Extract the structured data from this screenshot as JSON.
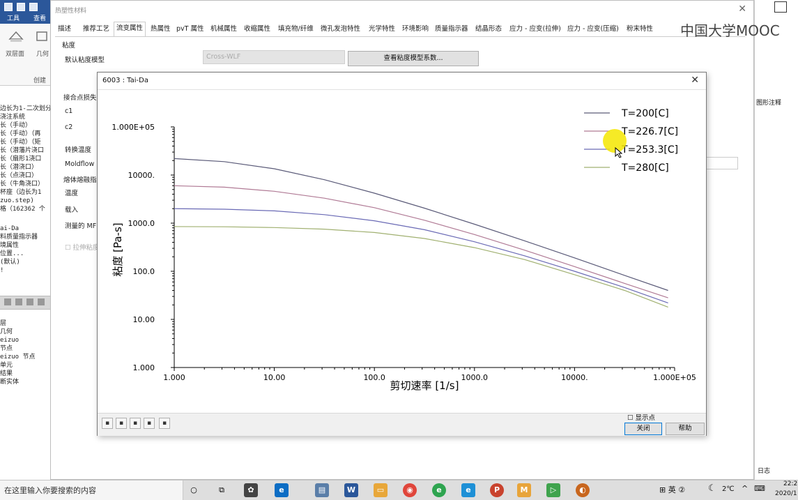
{
  "app": {
    "ribbon_tabs": [
      "工具",
      "查看"
    ],
    "ribbon_labels": [
      "双层面",
      "几何"
    ],
    "ribbon_group": "创建",
    "tree_top": [
      "边长为1-二次划分",
      "浇注系统",
      "长（手动）",
      "长（手动）（再",
      "长（手动）（矩",
      "长（潜藩片浇口",
      "长（扇形1浇口",
      "长（潜浇口）",
      "长（点浇口）",
      "长（牛角浇口）",
      "  杯座（边长为1",
      "zuo.step)",
      "格（162362 个"
    ],
    "tree_mid": [
      "ai-Da",
      "料质量指示器",
      "境属性",
      "位置...",
      " (默认)",
      "!"
    ],
    "tree_bottom": [
      "层",
      " 几何",
      "eizuo",
      "节点",
      "eizuo  节点",
      "单元",
      "结果",
      "断实体"
    ],
    "right_labels": [
      "图形注释",
      "日志"
    ],
    "watermark": "中国大学MOOC"
  },
  "bg_dialog": {
    "title": "热塑性材料",
    "tabs": [
      "描述",
      "推荐工艺",
      "流变属性",
      "热属性",
      "pvT 属性",
      "机械属性",
      "收缩属性",
      "填充物/纤维",
      "微孔发泡特性",
      "光学特性",
      "环境影响",
      "质量指示器",
      "结晶形态",
      "应力 - 应变(拉伸)",
      "应力 - 应变(压缩)",
      "粉末特性"
    ],
    "section": "粘度",
    "model_label": "默认粘度模型",
    "model_value": "Cross-WLF",
    "coeff_button": "查看粘度模型系数...",
    "labels": [
      "接合点损失",
      "c1",
      "c2",
      "转换温度",
      "Moldflow",
      "熔体熔融指",
      "温度",
      "载入",
      "测量的 MF",
      "拉伸粘度"
    ]
  },
  "plot_window": {
    "title": "6003 : Tai-Da",
    "show_points_label": "显示点",
    "close_button": "关闭",
    "help_button": "帮助"
  },
  "chart_data": {
    "type": "line",
    "xlabel": "剪切速率 [1/s]",
    "ylabel": "粘度 [Pa-s]",
    "x_scale": "log",
    "y_scale": "log",
    "xlim": [
      1,
      100000
    ],
    "ylim": [
      1,
      100000
    ],
    "x_ticks": [
      "1.000",
      "10.00",
      "100.0",
      "1000.0",
      "10000.",
      "1.000E+05"
    ],
    "y_ticks": [
      "1.000",
      "10.00",
      "100.0",
      "1000.0",
      "10000.",
      "1.000E+05"
    ],
    "grid": false,
    "legend": "top-right",
    "x": [
      1,
      3.16,
      10,
      31.6,
      100,
      316,
      1000,
      3160,
      10000,
      31600,
      86000
    ],
    "series": [
      {
        "name": "T=200[C]",
        "color": "#5a5a78",
        "values": [
          22000,
          19000,
          13500,
          8000,
          4200,
          2050,
          950,
          430,
          190,
          82,
          40
        ]
      },
      {
        "name": "T=226.7[C]",
        "color": "#b07a95",
        "values": [
          6000,
          5600,
          4600,
          3300,
          2100,
          1150,
          580,
          275,
          125,
          56,
          28
        ]
      },
      {
        "name": "T=253.3[C]",
        "color": "#6a6ab5",
        "values": [
          2000,
          1950,
          1800,
          1500,
          1120,
          730,
          410,
          210,
          100,
          46,
          22
        ]
      },
      {
        "name": "T=280[C]",
        "color": "#a0b070",
        "values": [
          850,
          840,
          810,
          750,
          640,
          480,
          310,
          175,
          85,
          40,
          18
        ]
      }
    ]
  },
  "taskbar": {
    "search_placeholder": "在这里输入你要搜索的内容",
    "ime": "英",
    "temperature": "2℃",
    "time": "22:2",
    "date": "2020/1"
  },
  "colors": {
    "accent": "#2b579a",
    "cursor_highlight": "#f5e600"
  }
}
